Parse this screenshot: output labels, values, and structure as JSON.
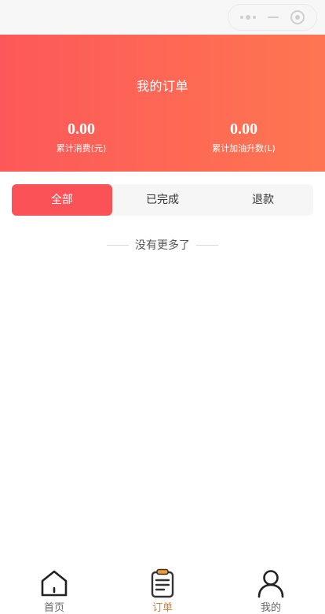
{
  "header": {
    "title": "我的订单",
    "stats": [
      {
        "value": "0.00",
        "label": "累计消费(元)"
      },
      {
        "value": "0.00",
        "label": "累计加油升数(L)"
      }
    ]
  },
  "tabs": [
    {
      "label": "全部",
      "active": true
    },
    {
      "label": "已完成",
      "active": false
    },
    {
      "label": "退款",
      "active": false
    }
  ],
  "list": {
    "empty_text": "没有更多了"
  },
  "tabbar": {
    "items": [
      {
        "label": "首页",
        "icon": "home-icon",
        "active": false
      },
      {
        "label": "订单",
        "icon": "clipboard-icon",
        "active": true
      },
      {
        "label": "我的",
        "icon": "user-icon",
        "active": false
      }
    ]
  },
  "colors": {
    "accent": "#fb5257",
    "gradient_start": "#fd5859",
    "gradient_end": "#fe7651",
    "tab_active_label": "#e07b2c"
  }
}
